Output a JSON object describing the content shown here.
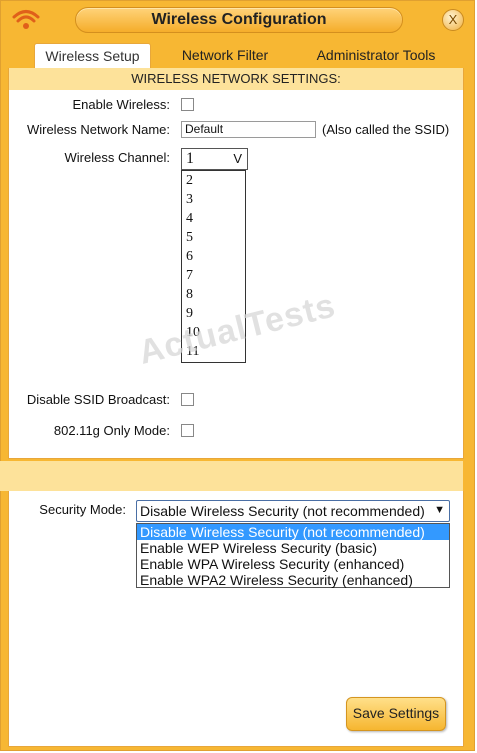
{
  "window": {
    "title": "Wireless Configuration",
    "close_glyph": "X",
    "icons": {
      "wifi": "wifi-icon",
      "close": "close-icon"
    }
  },
  "tabs": [
    {
      "label": "Wireless Setup",
      "active": true
    },
    {
      "label": "Network Filter",
      "active": false
    },
    {
      "label": "Administrator Tools",
      "active": false
    }
  ],
  "settings": {
    "header": "WIRELESS NETWORK SETTINGS:",
    "enable_wireless_label": "Enable Wireless:",
    "enable_wireless_checked": false,
    "network_name_label": "Wireless Network Name:",
    "network_name_value": "Default",
    "network_name_note": "(Also called the SSID)",
    "channel_label": "Wireless Channel:",
    "channel_value": "1",
    "channel_arrow": "V",
    "channel_options": [
      "2",
      "3",
      "4",
      "5",
      "6",
      "7",
      "8",
      "9",
      "10",
      "11"
    ],
    "disable_ssid_label": "Disable SSID Broadcast:",
    "disable_ssid_checked": false,
    "g_only_label": "802.11g Only Mode:",
    "g_only_checked": false
  },
  "security": {
    "label": "Security Mode:",
    "value": "Disable Wireless Security (not recommended)",
    "arrow": "▼",
    "options": [
      "Disable Wireless Security (not recommended)",
      "Enable WEP Wireless Security (basic)",
      "Enable WPA Wireless Security (enhanced)",
      "Enable WPA2 Wireless Security (enhanced)"
    ]
  },
  "watermark": "ActualTests",
  "save_label": "Save Settings",
  "colors": {
    "frame": "#f7b733",
    "header_band": "#fde29a",
    "selection": "#3399ff"
  }
}
